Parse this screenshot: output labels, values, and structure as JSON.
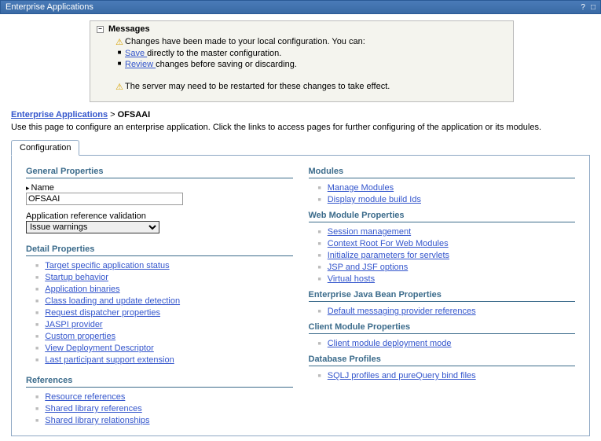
{
  "titlebar": {
    "title": "Enterprise Applications",
    "help": "?"
  },
  "messages": {
    "heading": "Messages",
    "items": [
      {
        "icon": "warn",
        "text": "Changes have been made to your local configuration. You can:"
      },
      {
        "icon": "bullet",
        "html": "<a href='#'>Save </a>directly to the master configuration."
      },
      {
        "icon": "bullet",
        "html": "<a href='#'>Review </a>changes before saving or discarding."
      },
      {
        "icon": "spacer",
        "text": ""
      },
      {
        "icon": "warn",
        "text": "The server may need to be restarted for these changes to take effect."
      }
    ]
  },
  "breadcrumb": {
    "link": "Enterprise Applications",
    "sep": " > ",
    "current": "OFSAAI"
  },
  "description": "Use this page to configure an enterprise application. Click the links to access pages for further configuring of the application or its modules.",
  "tab": {
    "label": "Configuration"
  },
  "general": {
    "heading": "General Properties",
    "name_label": "Name",
    "name_value": "OFSAAI",
    "validation_label": "Application reference validation",
    "validation_selected": "Issue warnings"
  },
  "detail": {
    "heading": "Detail Properties",
    "links": [
      "Target specific application status",
      "Startup behavior",
      "Application binaries",
      "Class loading and update detection",
      "Request dispatcher properties",
      "JASPI provider",
      "Custom properties",
      "View Deployment Descriptor",
      "Last participant support extension"
    ]
  },
  "references": {
    "heading": "References",
    "links": [
      "Resource references",
      "Shared library references",
      "Shared library relationships"
    ]
  },
  "modules": {
    "heading": "Modules",
    "links": [
      "Manage Modules",
      "Display module build Ids"
    ]
  },
  "webmod": {
    "heading": "Web Module Properties",
    "links": [
      "Session management",
      "Context Root For Web Modules",
      "Initialize parameters for servlets",
      "JSP and JSF options",
      "Virtual hosts"
    ]
  },
  "ejb": {
    "heading": "Enterprise Java Bean Properties",
    "links": [
      "Default messaging provider references"
    ]
  },
  "client": {
    "heading": "Client Module Properties",
    "links": [
      "Client module deployment mode"
    ]
  },
  "db": {
    "heading": "Database Profiles",
    "links": [
      "SQLJ profiles and pureQuery bind files"
    ]
  }
}
